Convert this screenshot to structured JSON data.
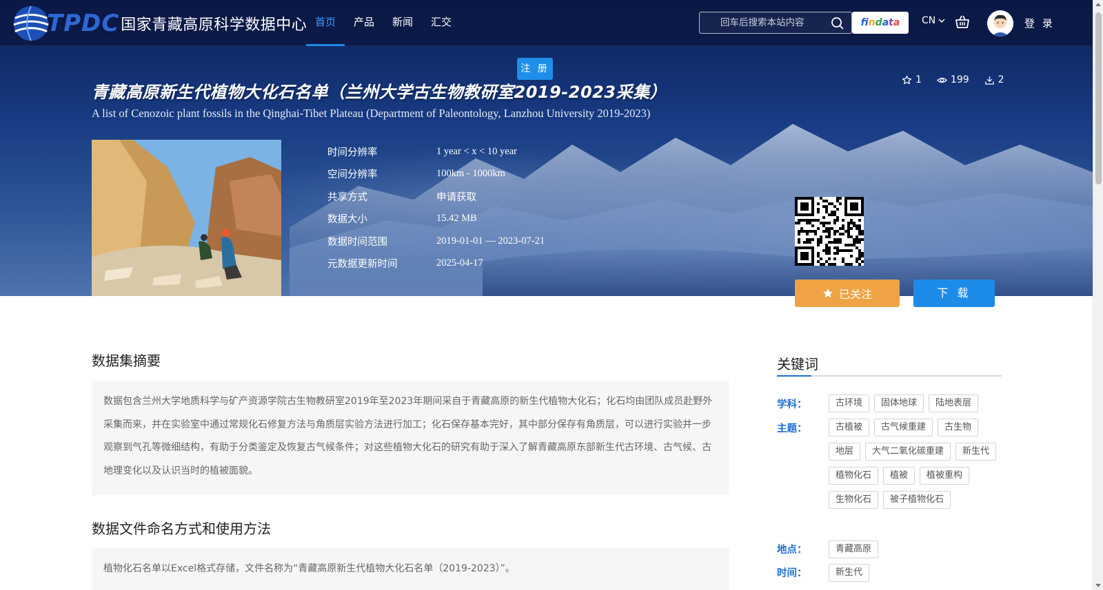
{
  "header": {
    "logo_text": "TPDC",
    "logo_cn": "国家青藏高原科学数据中心",
    "nav": [
      {
        "label": "首页",
        "active": true
      },
      {
        "label": "产品"
      },
      {
        "label": "新闻"
      },
      {
        "label": "汇交"
      }
    ],
    "search_placeholder": "回车后搜索本站内容",
    "findata": "findata",
    "lang": "CN",
    "login": "登 录",
    "icons": [
      "globe-logo-icon",
      "search-icon",
      "chevron-down-icon",
      "basket-icon",
      "avatar-icon"
    ]
  },
  "hero": {
    "register": "注 册",
    "title_cn": "青藏高原新生代植物大化石名单（兰州大学古生物教研室2019-2023采集）",
    "title_en": "A list of Cenozoic plant fossils in the Qinghai-Tibet Plateau (Department of Paleontology, Lanzhou University 2019-2023)",
    "stats": {
      "stars": "1",
      "views": "199",
      "downloads": "2"
    },
    "meta": [
      {
        "key": "时间分辨率",
        "value": "1 year < x < 10 year"
      },
      {
        "key": "空间分辨率",
        "value": "100km - 1000km"
      },
      {
        "key": "共享方式",
        "value": "申请获取"
      },
      {
        "key": "数据大小",
        "value": "15.42 MB"
      },
      {
        "key": "数据时间范围",
        "value": "2019-01-01 — 2023-07-21"
      },
      {
        "key": "元数据更新时间",
        "value": "2025-04-17"
      }
    ],
    "follow": "已关注",
    "download": "下 载"
  },
  "main": {
    "abstract_title": "数据集摘要",
    "abstract": "数据包含兰州大学地质科学与矿产资源学院古生物教研室2019年至2023年期间采自于青藏高原的新生代植物大化石；化石均由团队成员赴野外采集而来，并在实验室中通过常规化石修复方法与角质层实验方法进行加工；化石保存基本完好，其中部分保存有角质层，可以进行实验并一步观察到气孔等微细结构，有助于分类鉴定及恢复古气候条件；对这些植物大化石的研究有助于深入了解青藏高原东部新生代古环境、古气候、古地理变化以及认识当时的植被面貌。",
    "naming_title": "数据文件命名方式和使用方法",
    "naming": "植物化石名单以Excel格式存储，文件名称为“青藏高原新生代植物大化石名单（2019-2023）”。"
  },
  "keywords": {
    "title": "关键词",
    "discipline_label": "学科：",
    "discipline": [
      "古环境",
      "固体地球",
      "陆地表层"
    ],
    "theme_label": "主题：",
    "theme": [
      "古植被",
      "古气候重建",
      "古生物",
      "地层",
      "大气二氧化碳重建",
      "新生代",
      "植物化石",
      "植被",
      "植被重构",
      "生物化石",
      "被子植物化石"
    ],
    "place_label": "地点：",
    "place": [
      "青藏高原"
    ],
    "time_label": "时间：",
    "time": [
      "新生代"
    ]
  }
}
